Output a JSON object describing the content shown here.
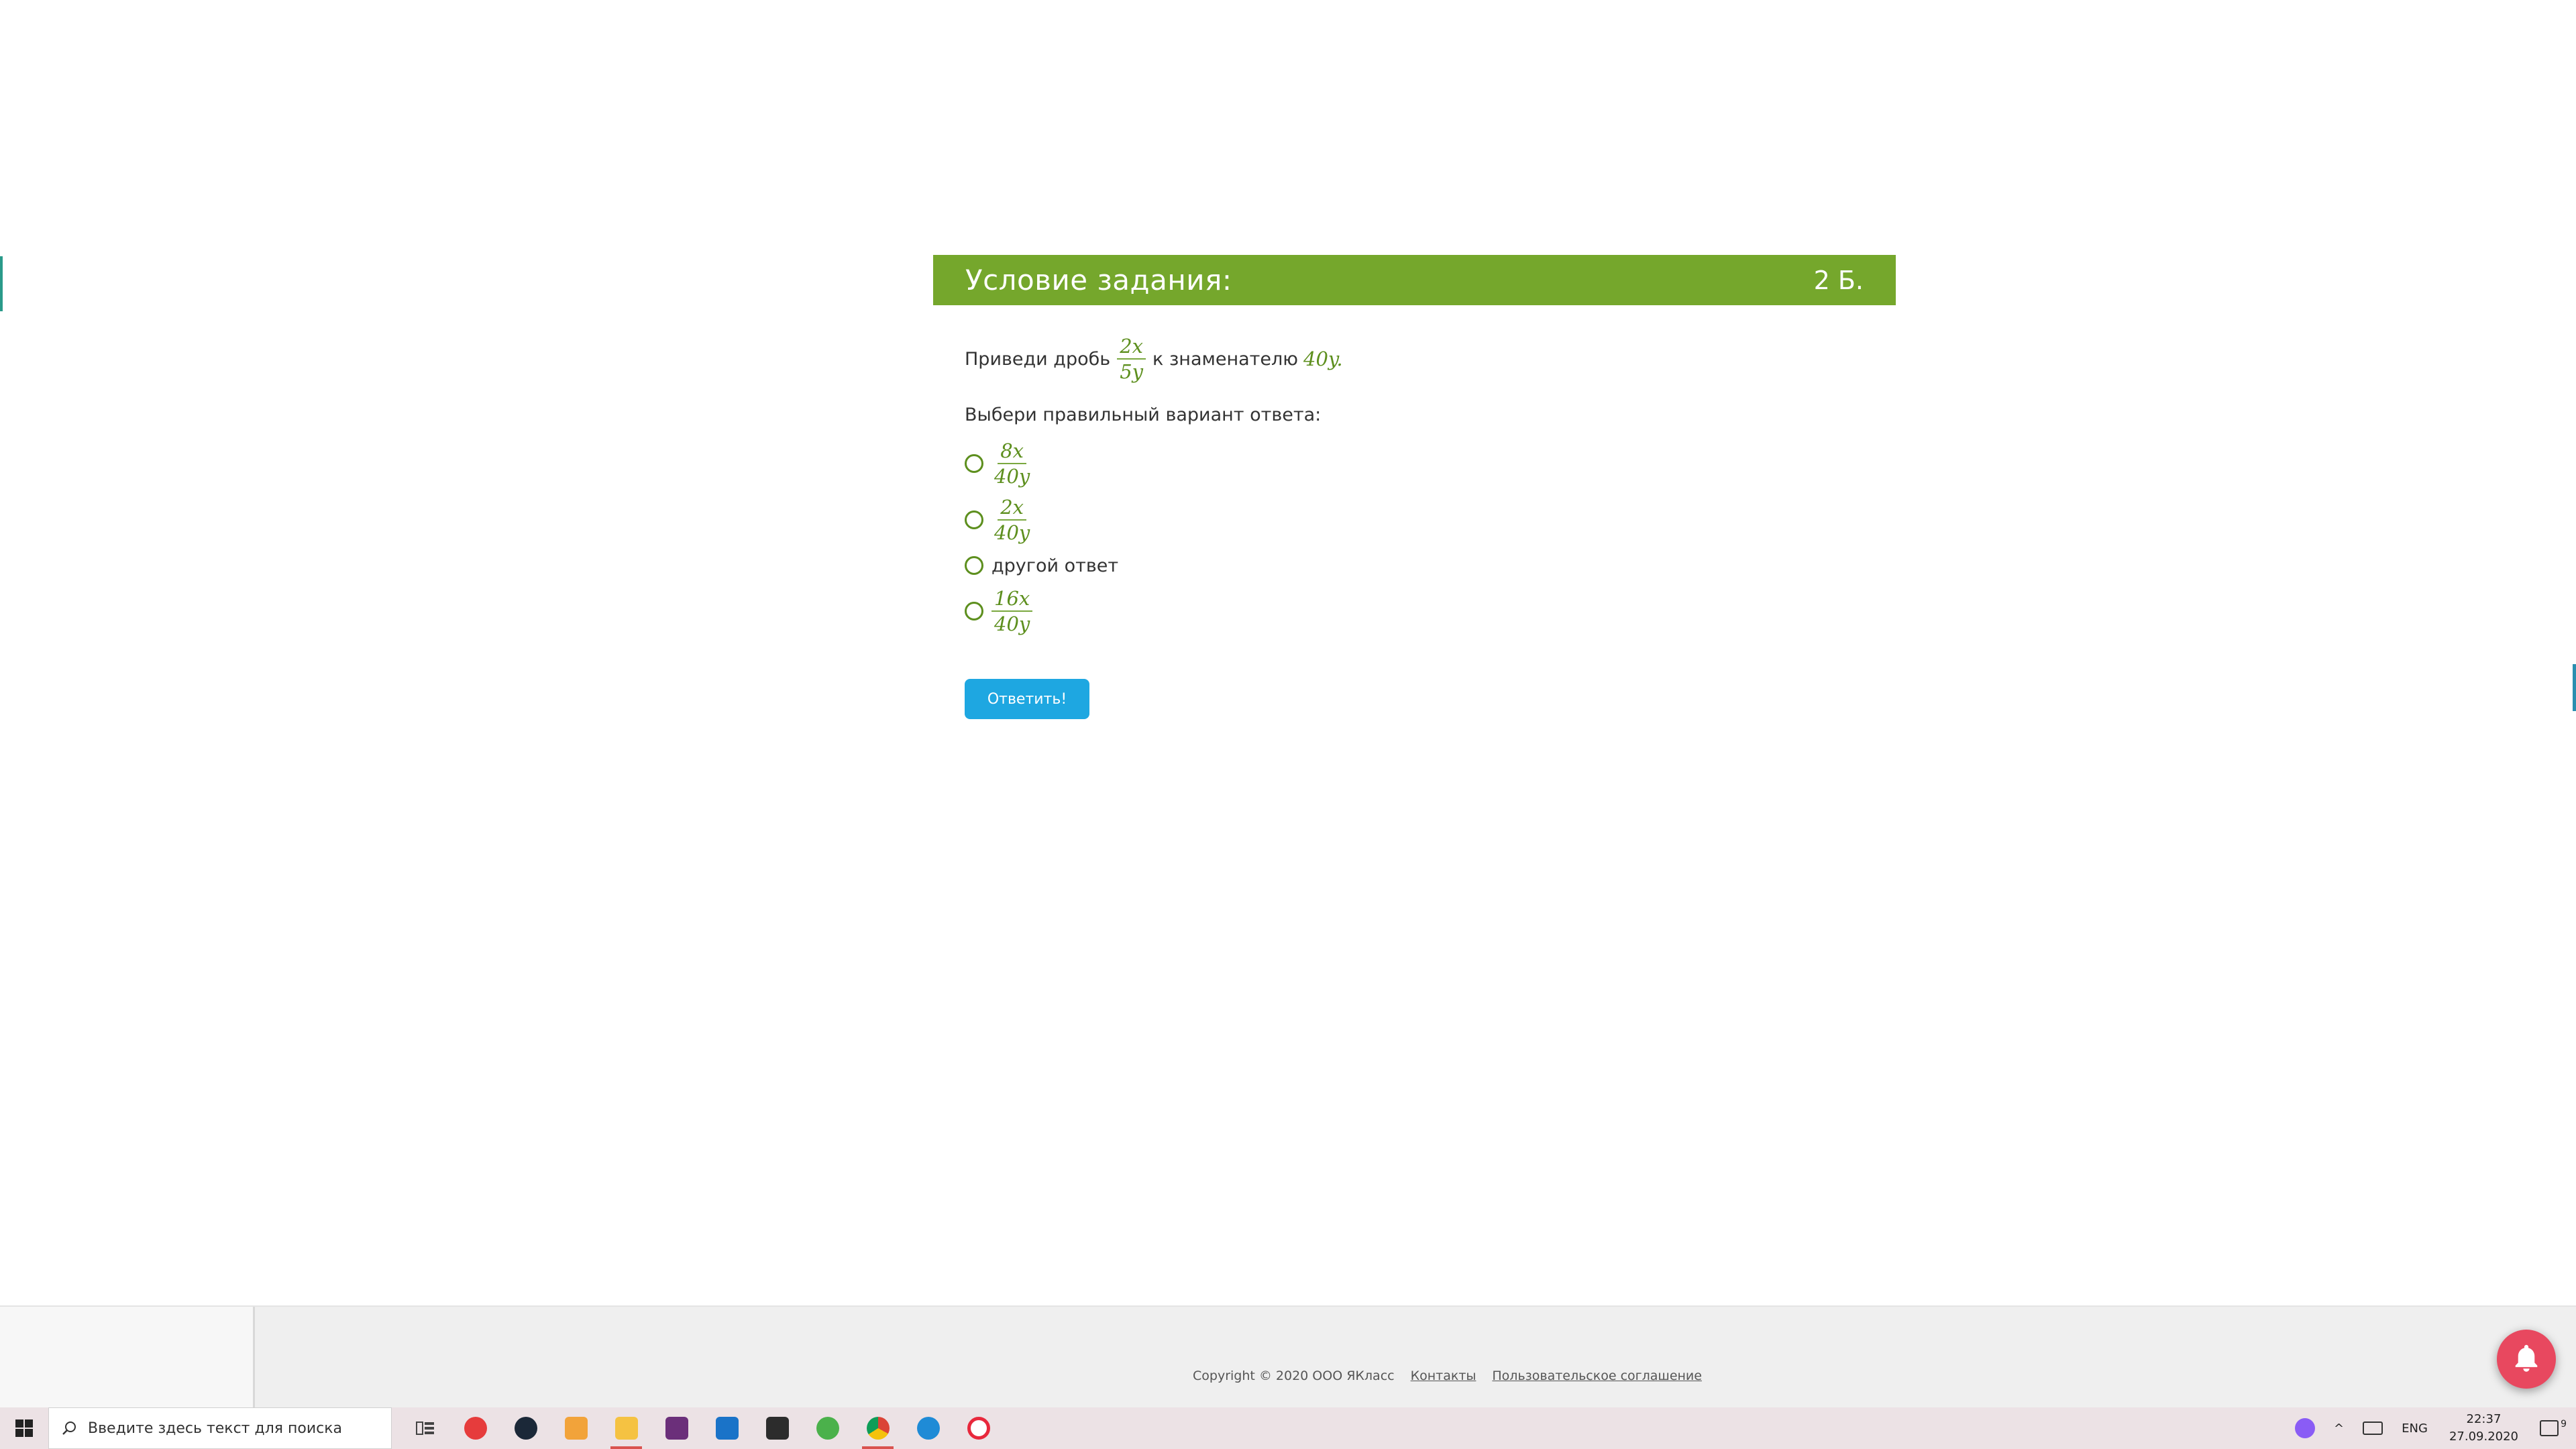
{
  "task": {
    "title": "Условие задания:",
    "points": "2 Б.",
    "question_prefix": "Приведи дробь",
    "fraction": {
      "num": "2x",
      "den": "5y"
    },
    "question_middle": "к знаменателю",
    "target": "40y.",
    "prompt": "Выбери правильный вариант ответа:",
    "options": [
      {
        "num": "8x",
        "den": "40y"
      },
      {
        "num": "2x",
        "den": "40y"
      },
      {
        "text": "другой ответ"
      },
      {
        "num": "16x",
        "den": "40y"
      }
    ],
    "submit_label": "Ответить!"
  },
  "footer": {
    "copyright": "Copyright © 2020 ООО ЯКласс",
    "contacts": "Контакты",
    "agreement": "Пользовательское соглашение"
  },
  "taskbar": {
    "search_placeholder": "Введите здесь текст для поиска",
    "language": "ENG",
    "time": "22:37",
    "date": "27.09.2020",
    "notification_count": "9",
    "icons": [
      "task-view-icon",
      "yandex-browser-icon",
      "steam-icon",
      "media-player-icon",
      "file-explorer-icon",
      "winrar-icon",
      "mail-icon",
      "store-icon",
      "utorrent-icon",
      "chrome-icon",
      "edge-icon",
      "opera-icon"
    ]
  },
  "colors": {
    "header_green": "#75a72c",
    "math_green": "#5d8f1e",
    "button_blue": "#1ea7e1",
    "bell_red": "#e8485f"
  }
}
